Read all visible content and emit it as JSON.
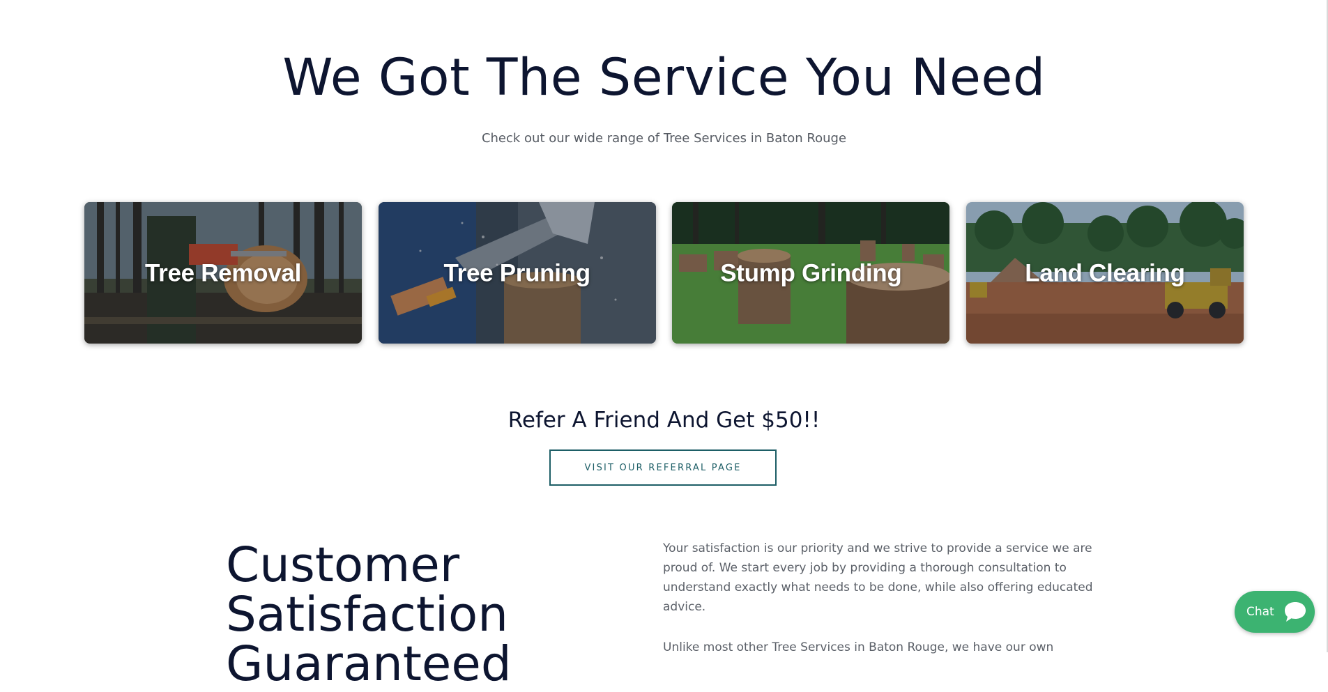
{
  "hero": {
    "title": "We Got The Service You Need",
    "subtitle": "Check out our wide range of Tree Services in Baton Rouge"
  },
  "services": [
    {
      "label": "Tree Removal",
      "icon": "chainsaw-photo"
    },
    {
      "label": "Tree Pruning",
      "icon": "axe-photo"
    },
    {
      "label": "Stump Grinding",
      "icon": "stumps-photo"
    },
    {
      "label": "Land Clearing",
      "icon": "excavator-photo"
    }
  ],
  "referral": {
    "title": "Refer A Friend And Get $50!!",
    "button_label": "VISIT OUR REFERRAL PAGE"
  },
  "satisfaction": {
    "title": "Customer Satisfaction Guaranteed",
    "paragraph1": "Your satisfaction is our priority and we strive to provide a service we are proud of.  We start every job by providing a thorough consultation to understand exactly what needs to be done, while also offering educated advice.",
    "paragraph2": "Unlike most other Tree Services in Baton Rouge, we have our own"
  },
  "chat": {
    "label": "Chat",
    "icon": "chat-bubble-icon"
  },
  "colors": {
    "heading": "#0d1530",
    "body_text": "#5b6068",
    "accent_teal": "#1d5e66",
    "chat_green": "#3cb371"
  }
}
